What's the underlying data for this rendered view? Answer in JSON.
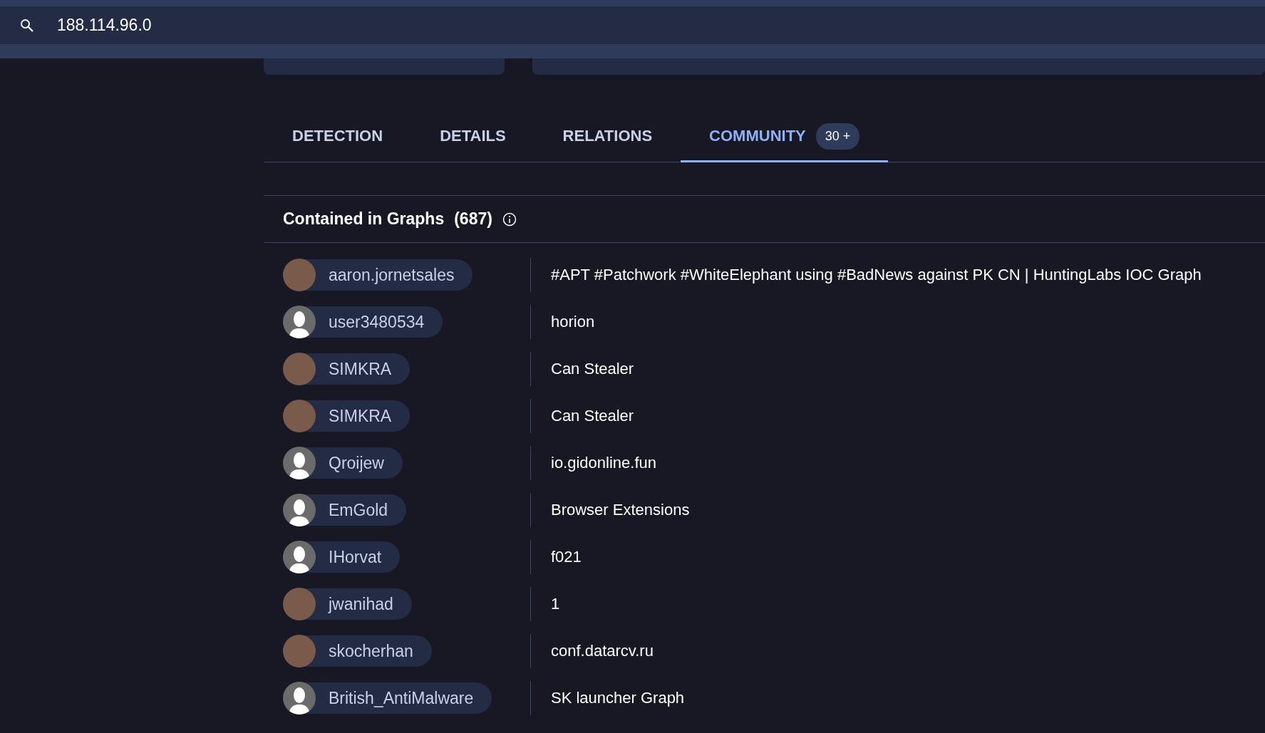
{
  "search": {
    "value": "188.114.96.0"
  },
  "tabs": [
    {
      "label": "DETECTION",
      "selected": false
    },
    {
      "label": "DETAILS",
      "selected": false
    },
    {
      "label": "RELATIONS",
      "selected": false
    },
    {
      "label": "COMMUNITY",
      "selected": true,
      "badge": "30 +"
    }
  ],
  "graphs": {
    "title": "Contained in Graphs",
    "count": "(687)",
    "rows": [
      {
        "user": "aaron.jornetsales",
        "kind": "image",
        "title": "#APT #Patchwork #WhiteElephant using #BadNews against PK CN | HuntingLabs IOC Graph"
      },
      {
        "user": "user3480534",
        "kind": "silhouette",
        "title": "horion"
      },
      {
        "user": "SIMKRA",
        "kind": "image",
        "title": "Can Stealer"
      },
      {
        "user": "SIMKRA",
        "kind": "image",
        "title": "Can Stealer"
      },
      {
        "user": "Qroijew",
        "kind": "silhouette",
        "title": "io.gidonline.fun"
      },
      {
        "user": "EmGold",
        "kind": "silhouette",
        "title": "Browser Extensions"
      },
      {
        "user": "IHorvat",
        "kind": "silhouette",
        "title": "f021"
      },
      {
        "user": "jwanihad",
        "kind": "image",
        "title": "1"
      },
      {
        "user": "skocherhan",
        "kind": "image",
        "title": "conf.datarcv.ru"
      },
      {
        "user": "British_AntiMalware",
        "kind": "silhouette",
        "title": "SK launcher Graph"
      }
    ]
  }
}
